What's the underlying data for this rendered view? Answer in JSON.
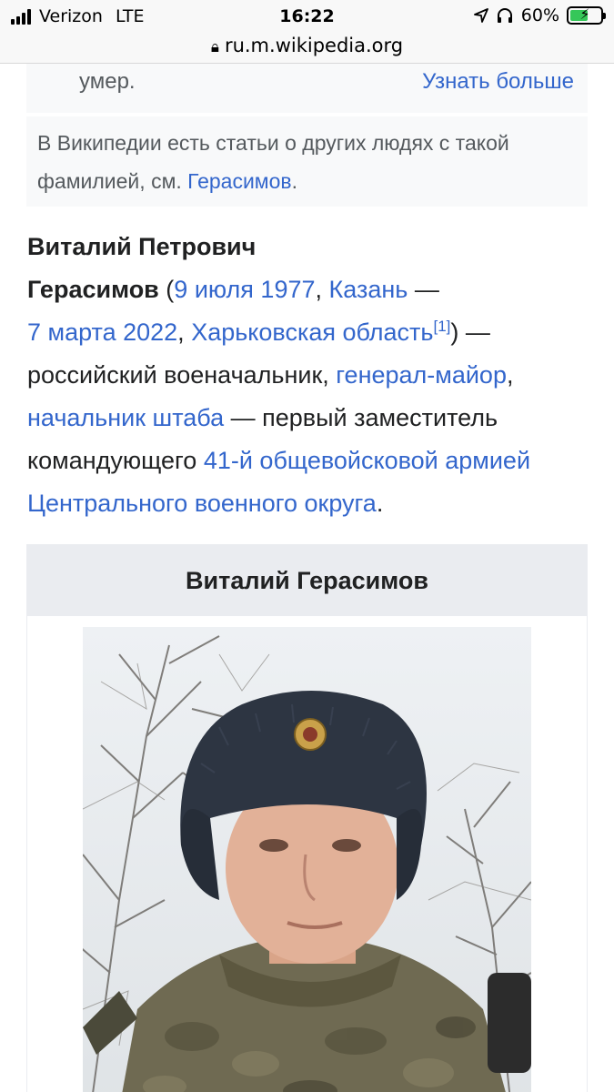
{
  "status_bar": {
    "carrier": "Verizon",
    "network": "LTE",
    "time": "16:22",
    "battery_percent": "60%",
    "battery_level": 0.6,
    "icons": [
      "signal-icon",
      "location-icon",
      "headphones-icon",
      "battery-icon"
    ]
  },
  "browser": {
    "url": "ru.m.wikipedia.org"
  },
  "notice_top": {
    "text": "умер.",
    "link": "Узнать больше"
  },
  "notice_hatnote": {
    "text": "В Википедии есть статьи о других людях с такой фамилией, см. ",
    "link": "Герасимов",
    "end": "."
  },
  "lead": {
    "name_line1": "Виталий Петрович",
    "name_line2": "Герасимов",
    "open_paren": " (",
    "birth_date": "9 июля 1977",
    "comma1": ", ",
    "birth_place": "Казань",
    "dash1": " —",
    "death_date": "7 марта 2022",
    "comma2": ", ",
    "death_place": "Харьковская область",
    "ref": "[1]",
    "after_ref": ") —",
    "desc1": "российский военачальник, ",
    "rank": "генерал-майор",
    "comma3": ",",
    "position": "начальник штаба",
    "desc2": " — первый заместитель командующего ",
    "army": "41-й общевойсковой армией Центрального военного округа",
    "end": "."
  },
  "infobox": {
    "title": "Виталий Герасимов"
  },
  "colors": {
    "link": "#3366cc",
    "text": "#202122",
    "notice_bg": "#f8f9fa",
    "infobox_header": "#eaecf0"
  }
}
